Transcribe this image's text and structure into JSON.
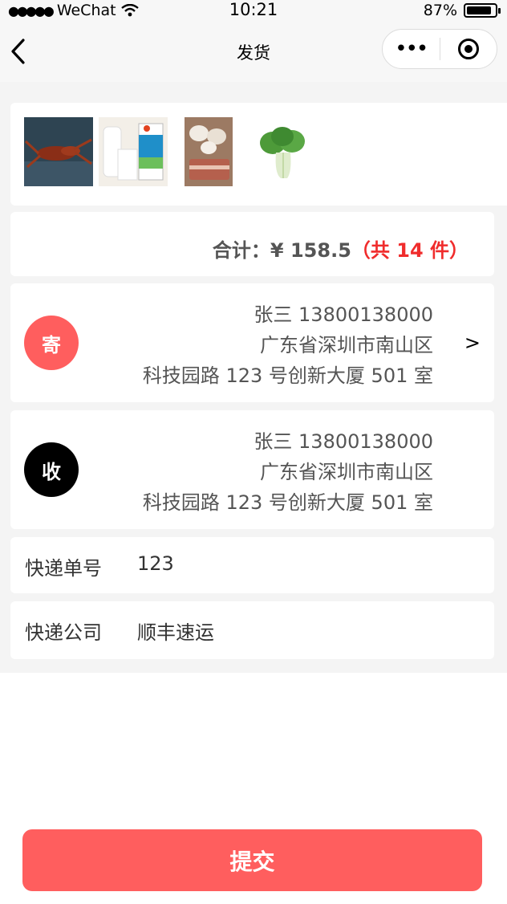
{
  "status_bar": {
    "carrier": "WeChat",
    "time": "10:21",
    "battery": "87%",
    "battery_level": 0.87
  },
  "nav": {
    "title": "发货"
  },
  "goods": {
    "thumbs": [
      "crayfish-image",
      "milk-image",
      "bacon-eggs-image",
      "bok-choy-image"
    ]
  },
  "total": {
    "label": "合计：¥ 158.5",
    "count": "（共 14 件）"
  },
  "sender": {
    "badge": "寄",
    "line1": "张三 13800138000",
    "line2": "广东省深圳市南山区",
    "line3": "科技园路 123 号创新大厦 501 室",
    "chevron": ">"
  },
  "receiver": {
    "badge": "收",
    "line1": "张三 13800138000",
    "line2": "广东省深圳市南山区",
    "line3": "科技园路 123 号创新大厦 501 室"
  },
  "form": {
    "tracking_label": "快递单号",
    "tracking_value": "123",
    "company_label": "快递公司",
    "company_value": "顺丰速运"
  },
  "submit_label": "提交",
  "colors": {
    "accent": "#ff5e5e",
    "count_red": "#f02c2c"
  }
}
